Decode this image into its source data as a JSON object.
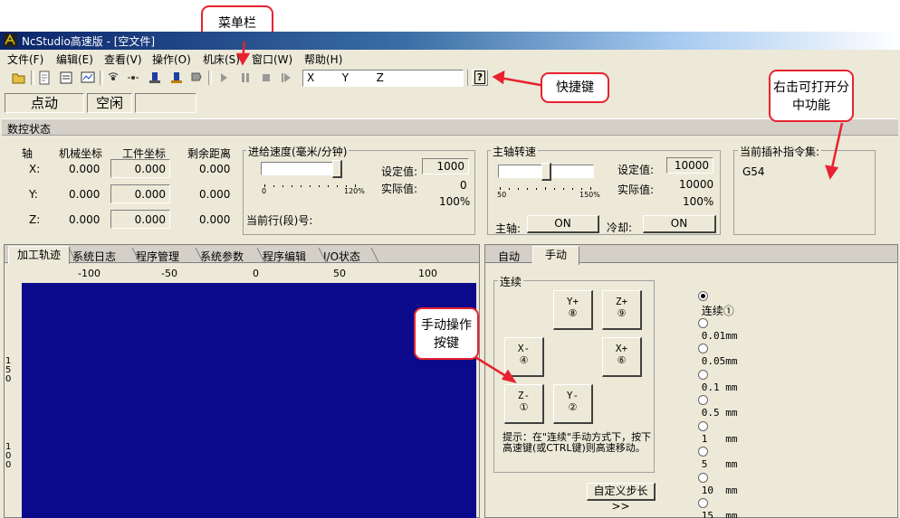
{
  "window": {
    "title": "NcStudio高速版 - [空文件]"
  },
  "menu": [
    "文件(F)",
    "编辑(E)",
    "查看(V)",
    "操作(O)",
    "机床(S)",
    "窗口(W)",
    "帮助(H)"
  ],
  "toolbar": {
    "coord_display": "X        Y        Z",
    "help_glyph": "?"
  },
  "modes": {
    "mode1": "点动",
    "mode2": "空闲",
    "mode3": ""
  },
  "status": {
    "section_title": "数控状态",
    "headers": {
      "axis": "轴",
      "machine": "机械坐标",
      "work": "工件坐标",
      "remaining": "剩余距离"
    },
    "rows": [
      {
        "axis": "X:",
        "machine": "0.000",
        "work": "0.000",
        "remaining": "0.000"
      },
      {
        "axis": "Y:",
        "machine": "0.000",
        "work": "0.000",
        "remaining": "0.000"
      },
      {
        "axis": "Z:",
        "machine": "0.000",
        "work": "0.000",
        "remaining": "0.000"
      }
    ],
    "feed": {
      "title": "进给速度(毫米/分钟)",
      "set_label": "设定值:",
      "set_value": "1000",
      "actual_label": "实际值:",
      "actual_value": "0",
      "percent": "100%",
      "scale_min": "0",
      "scale_max": "120%",
      "current_line_label": "当前行(段)号:",
      "slider_fraction": 0.83
    },
    "spindle": {
      "title": "主轴转速",
      "set_label": "设定值:",
      "set_value": "10000",
      "actual_label": "实际值:",
      "actual_value": "10000",
      "percent": "100%",
      "scale_min": "50",
      "scale_max": "150%",
      "spindle_label": "主轴:",
      "spindle_btn": "ON",
      "cool_label": "冷却:",
      "cool_btn": "ON",
      "slider_fraction": 0.5
    },
    "interp": {
      "title": "当前插补指令集:",
      "value": "G54"
    }
  },
  "left_tabs": [
    "加工轨迹",
    "系统日志",
    "程序管理",
    "系统参数",
    "程序编辑",
    "I/O状态"
  ],
  "ruler": {
    "x_ticks": [
      "-100",
      "-50",
      "0",
      "50",
      "100"
    ],
    "y_ticks": [
      "150",
      "100"
    ]
  },
  "right_tabs": [
    "自动",
    "手动"
  ],
  "jog": {
    "group_title": "连续",
    "buttons": {
      "yplus": {
        "top": "Y+",
        "bottom": "⑧"
      },
      "zplus": {
        "top": "Z+",
        "bottom": "⑨"
      },
      "xminus": {
        "top": "X-",
        "bottom": "④"
      },
      "xplus": {
        "top": "X+",
        "bottom": "⑥"
      },
      "zminus": {
        "top": "Z-",
        "bottom": "①"
      },
      "yminus": {
        "top": "Y-",
        "bottom": "②"
      }
    },
    "hint": "提示：在\"连续\"手动方式下，按下高速键(或CTRL键)则高速移动。",
    "custom_step": "自定义步长>>",
    "steps": [
      "连续①",
      "0.01mm",
      "0.05mm",
      "0.1 mm",
      "0.5 mm",
      "1   mm",
      "5   mm",
      "10  mm",
      "15  mm"
    ]
  },
  "callouts": {
    "menubar": "菜单栏",
    "shortcut": "快捷键",
    "rightclick": "右击可打开分中功能",
    "manual": "手动操作按键"
  },
  "colors": {
    "canvas": "#0a0a8a",
    "callout_border": "#e8232f",
    "chrome": "#ece9d8"
  }
}
